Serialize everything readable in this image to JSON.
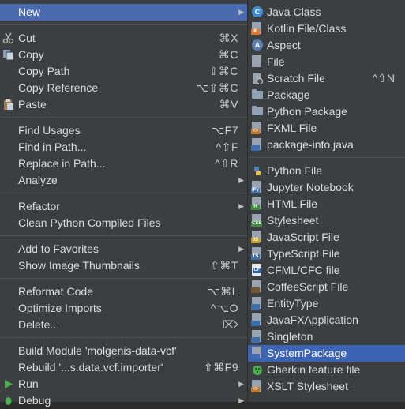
{
  "main_menu": {
    "items": [
      {
        "label": "New",
        "shortcut": "",
        "submenu": true,
        "highlighted": true
      },
      {
        "label": "Cut",
        "shortcut": "⌘X",
        "icon": "scissors-icon"
      },
      {
        "label": "Copy",
        "shortcut": "⌘C",
        "icon": "copy-icon"
      },
      {
        "label": "Copy Path",
        "shortcut": "⇧⌘C"
      },
      {
        "label": "Copy Reference",
        "shortcut": "⌥⇧⌘C"
      },
      {
        "label": "Paste",
        "shortcut": "⌘V",
        "icon": "paste-icon"
      },
      {
        "label": "Find Usages",
        "shortcut": "⌥F7"
      },
      {
        "label": "Find in Path...",
        "shortcut": "^⇧F"
      },
      {
        "label": "Replace in Path...",
        "shortcut": "^⇧R"
      },
      {
        "label": "Analyze",
        "shortcut": "",
        "submenu": true
      },
      {
        "label": "Refactor",
        "shortcut": "",
        "submenu": true
      },
      {
        "label": "Clean Python Compiled Files",
        "shortcut": ""
      },
      {
        "label": "Add to Favorites",
        "shortcut": "",
        "submenu": true
      },
      {
        "label": "Show Image Thumbnails",
        "shortcut": "⇧⌘T"
      },
      {
        "label": "Reformat Code",
        "shortcut": "⌥⌘L"
      },
      {
        "label": "Optimize Imports",
        "shortcut": "^⌥O"
      },
      {
        "label": "Delete...",
        "shortcut": "⌦"
      },
      {
        "label": "Build Module 'molgenis-data-vcf'",
        "shortcut": ""
      },
      {
        "label": "Rebuild '...s.data.vcf.importer'",
        "shortcut": "⇧⌘F9"
      },
      {
        "label": "Run",
        "shortcut": "",
        "submenu": true,
        "icon": "run-icon"
      },
      {
        "label": "Debug",
        "shortcut": "",
        "submenu": true,
        "icon": "debug-icon"
      }
    ]
  },
  "new_submenu": {
    "items": [
      {
        "label": "Java Class",
        "icon": "java-class-icon"
      },
      {
        "label": "Kotlin File/Class",
        "icon": "kotlin-file-icon"
      },
      {
        "label": "Aspect",
        "icon": "aspect-icon"
      },
      {
        "label": "File",
        "icon": "file-icon"
      },
      {
        "label": "Scratch File",
        "shortcut": "^⇧N",
        "icon": "scratch-file-icon"
      },
      {
        "label": "Package",
        "icon": "package-icon"
      },
      {
        "label": "Python Package",
        "icon": "python-package-icon"
      },
      {
        "label": "FXML File",
        "icon": "fxml-file-icon"
      },
      {
        "label": "package-info.java",
        "icon": "package-info-icon"
      },
      {
        "label": "Python File",
        "icon": "python-file-icon"
      },
      {
        "label": "Jupyter Notebook",
        "icon": "jupyter-notebook-icon"
      },
      {
        "label": "HTML File",
        "icon": "html-file-icon"
      },
      {
        "label": "Stylesheet",
        "icon": "stylesheet-icon"
      },
      {
        "label": "JavaScript File",
        "icon": "javascript-file-icon"
      },
      {
        "label": "TypeScript File",
        "icon": "typescript-file-icon"
      },
      {
        "label": "CFML/CFC file",
        "icon": "cfml-file-icon"
      },
      {
        "label": "CoffeeScript File",
        "icon": "coffeescript-file-icon"
      },
      {
        "label": "EntityType",
        "icon": "entitytype-icon"
      },
      {
        "label": "JavaFXApplication",
        "icon": "javafx-application-icon"
      },
      {
        "label": "Singleton",
        "icon": "singleton-icon"
      },
      {
        "label": "SystemPackage",
        "icon": "system-package-icon",
        "highlighted": true
      },
      {
        "label": "Gherkin feature file",
        "icon": "gherkin-file-icon"
      },
      {
        "label": "XSLT Stylesheet",
        "icon": "xslt-stylesheet-icon"
      }
    ]
  },
  "icon_text": {
    "java": "C",
    "kotlin": "K",
    "aspect": "A",
    "ipynb": "IPy",
    "html": "H",
    "css": "CSS",
    "js": "JS",
    "ts": "TS",
    "cf": "CF",
    "fxml": "<>",
    "xslt": "<>"
  },
  "colors": {
    "menu_bg": "#3c3f41",
    "highlight": "#4a6ab0",
    "text": "#dcdcdc",
    "run_green": "#4caf50",
    "java_blue": "#3d8fd1"
  }
}
